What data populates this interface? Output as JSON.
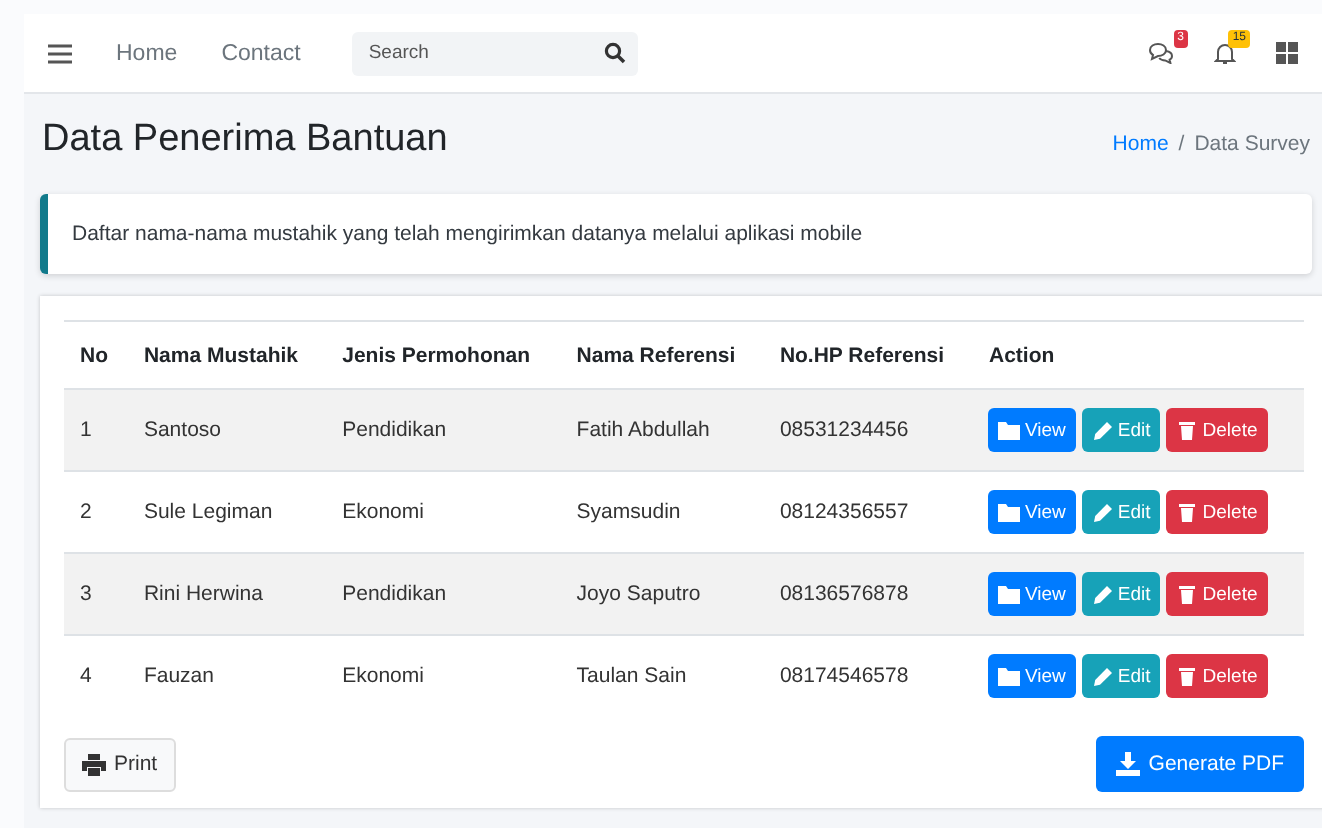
{
  "navbar": {
    "links": [
      "Home",
      "Contact"
    ],
    "search": {
      "placeholder": "Search"
    },
    "badges": [
      {
        "kind": "messages",
        "count": "3",
        "color": "#dc3545"
      },
      {
        "kind": "notifications",
        "count": "15",
        "color": "#ffc107"
      }
    ]
  },
  "page": {
    "title": "Data Penerima Bantuan",
    "breadcrumb": [
      {
        "label": "Home",
        "selected": false
      },
      {
        "label": "Data Survey",
        "selected": true
      }
    ],
    "breadcrumb_separator": "/"
  },
  "callout": "Daftar nama-nama mustahik yang telah mengirimkan datanya melalui aplikasi mobile",
  "table": {
    "columns": [
      "No",
      "Nama Mustahik",
      "Jenis Permohonan",
      "Nama Referensi",
      "No.HP Referensi",
      "Action"
    ],
    "rows": [
      {
        "cells": [
          "1",
          "Santoso",
          "Pendidikan",
          "Fatih Abdullah",
          "08531234456"
        ],
        "actions": [
          {
            "kind": "view",
            "label": "View"
          },
          {
            "kind": "edit",
            "label": "Edit"
          },
          {
            "kind": "delete",
            "label": "Delete"
          }
        ]
      },
      {
        "cells": [
          "2",
          "Sule Legiman",
          "Ekonomi",
          "Syamsudin",
          "08124356557"
        ],
        "actions": [
          {
            "kind": "view",
            "label": "View"
          },
          {
            "kind": "edit",
            "label": "Edit"
          },
          {
            "kind": "delete",
            "label": "Delete"
          }
        ]
      },
      {
        "cells": [
          "3",
          "Rini Herwina",
          "Pendidikan",
          "Joyo Saputro",
          "08136576878"
        ],
        "actions": [
          {
            "kind": "view",
            "label": "View"
          },
          {
            "kind": "edit",
            "label": "Edit"
          },
          {
            "kind": "delete",
            "label": "Delete"
          }
        ]
      },
      {
        "cells": [
          "4",
          "Fauzan",
          "Ekonomi",
          "Taulan Sain",
          "08174546578"
        ],
        "actions": [
          {
            "kind": "view",
            "label": "View"
          },
          {
            "kind": "edit",
            "label": "Edit"
          },
          {
            "kind": "delete",
            "label": "Delete"
          }
        ]
      }
    ]
  },
  "footer": {
    "print": "Print",
    "generate": "Generate PDF"
  }
}
